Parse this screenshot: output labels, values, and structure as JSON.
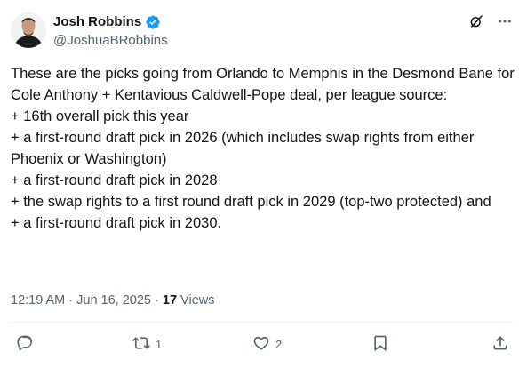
{
  "author": {
    "name": "Josh Robbins",
    "handle": "@JoshuaBRobbins"
  },
  "tweet": {
    "text": "These are the picks going from Orlando to Memphis in the Desmond Bane for Cole Anthony + Kentavious Caldwell-Pope deal, per league source:\n+ 16th overall pick this year\n+ a first-round draft pick in 2026 (which includes swap rights from either Phoenix or Washington)\n+ a first-round draft pick in 2028\n+ the swap rights to a first round draft pick in 2029 (top-two protected) and\n+ a first-round draft pick in 2030."
  },
  "meta": {
    "timestamp": "12:19 AM · Jun 16, 2025 · ",
    "views_count": "17",
    "views_label": " Views"
  },
  "actions": {
    "replies": "",
    "reposts": "1",
    "likes": "2"
  },
  "colors": {
    "verified": "#1d9bf0",
    "secondary_text": "#536471",
    "primary_text": "#0f1419"
  },
  "icons": [
    "verified-badge-icon",
    "grok-icon",
    "more-icon",
    "reply-icon",
    "repost-icon",
    "like-icon",
    "bookmark-icon",
    "share-icon"
  ]
}
